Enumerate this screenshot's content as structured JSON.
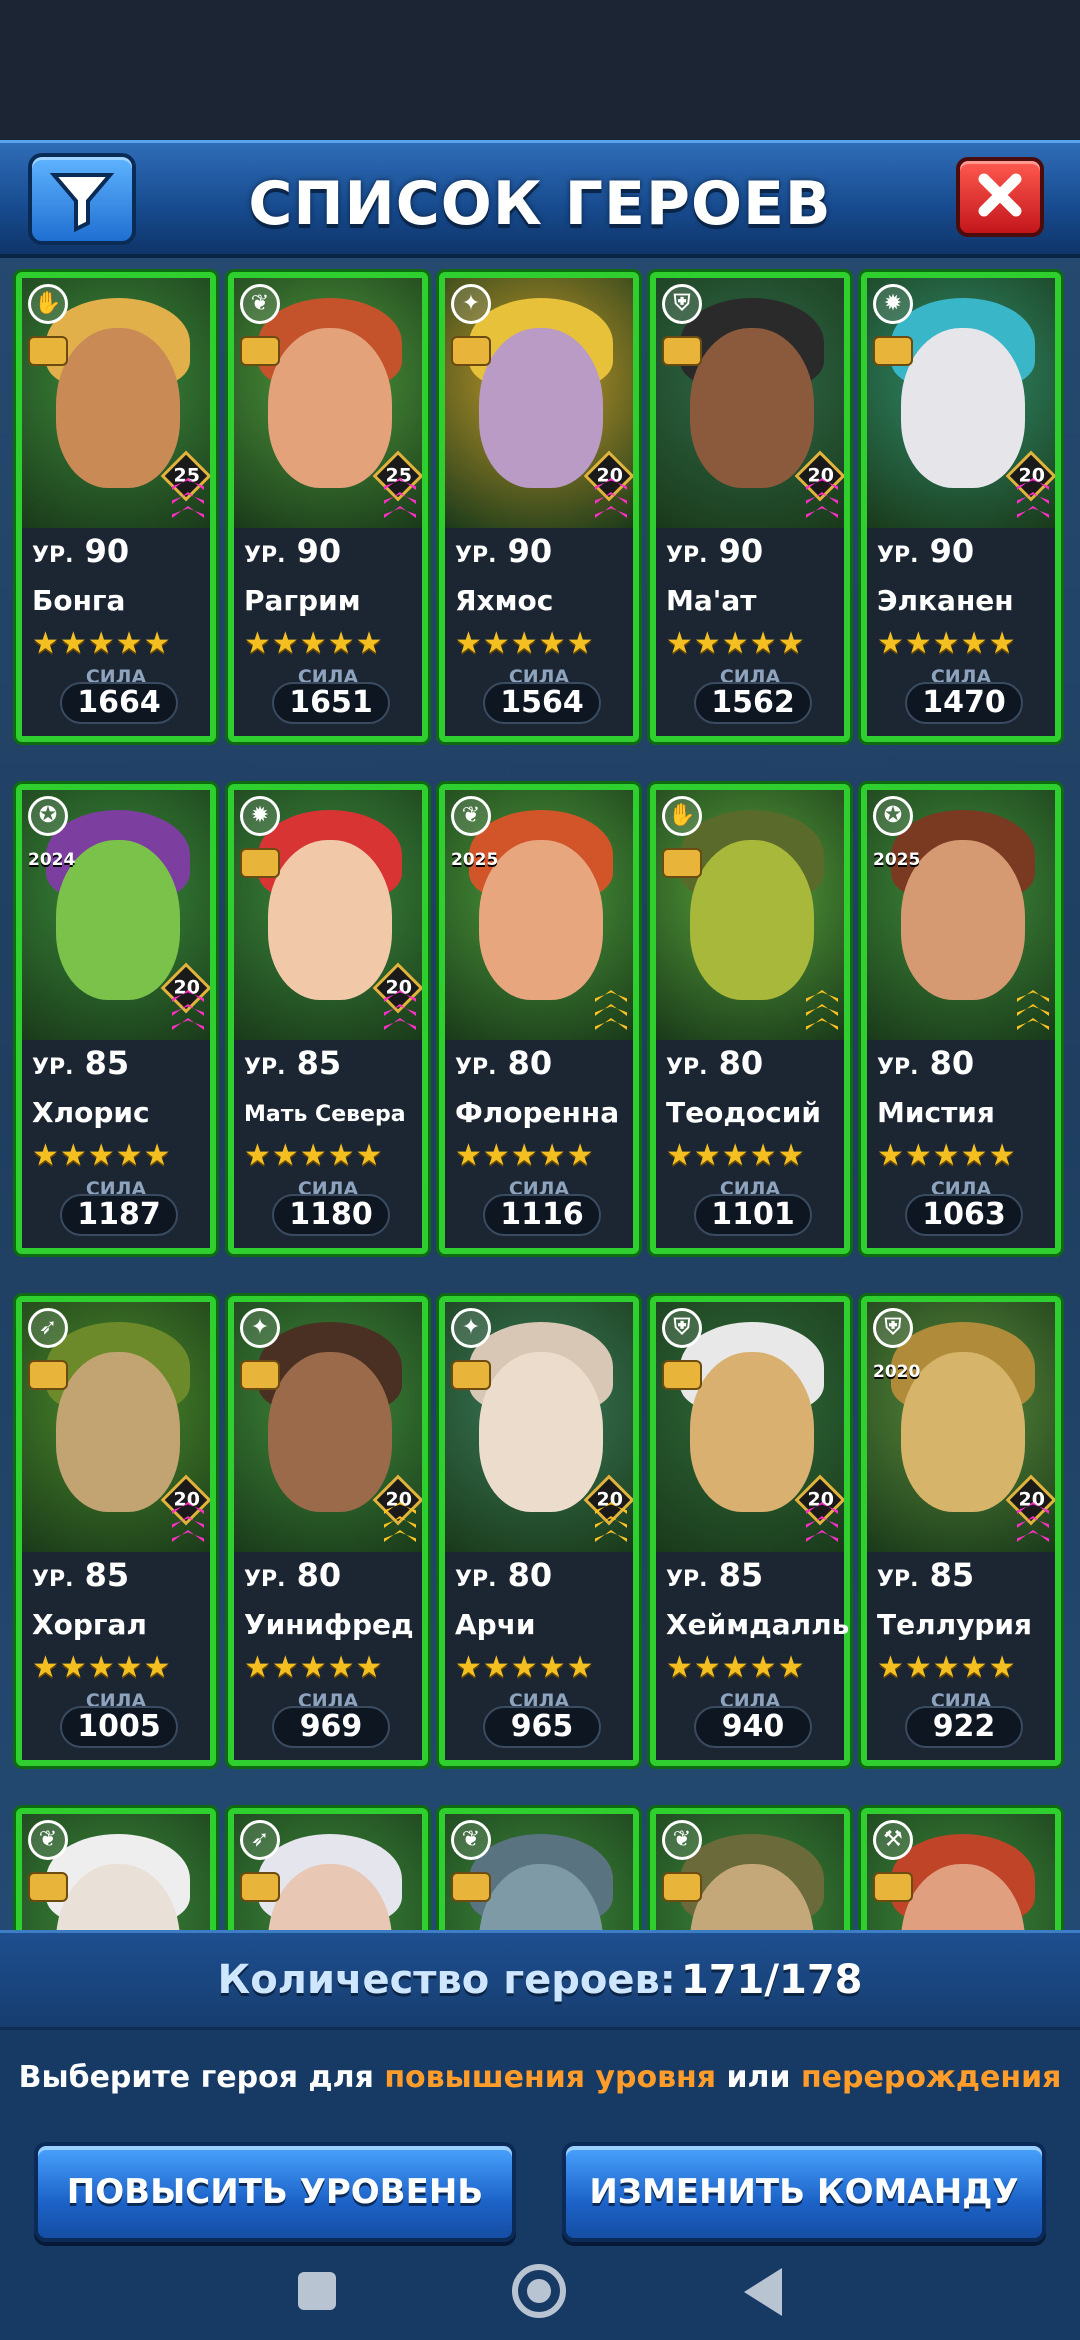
{
  "header": {
    "title": "СПИСОК ГЕРОЕВ"
  },
  "level_prefix": "УР.",
  "power_label": "СИЛА",
  "heroes": [
    {
      "name": "Бонга",
      "level": "90",
      "stars": "★★★★★",
      "power": "1664",
      "lvl_badge": "25",
      "class": "✋",
      "bg": "#3d8a3a",
      "skin": "#c98a55",
      "hair": "#e2b04a",
      "chev": "#ff2fc8"
    },
    {
      "name": "Рагрим",
      "level": "90",
      "stars": "★★★★★",
      "power": "1651",
      "lvl_badge": "25",
      "class": "❦",
      "bg": "#4f9a3c",
      "skin": "#e3a27a",
      "hair": "#c4532c",
      "chev": "#ff2fc8"
    },
    {
      "name": "Яхмос",
      "level": "90",
      "stars": "★★★★★",
      "power": "1564",
      "lvl_badge": "20",
      "class": "✦",
      "bg": "#c89b2a",
      "skin": "#b99bc5",
      "hair": "#e7c13a",
      "chev": "#ff2fc8"
    },
    {
      "name": "Ма'ат",
      "level": "90",
      "stars": "★★★★★",
      "power": "1562",
      "lvl_badge": "20",
      "class": "⛨",
      "bg": "#2f6a4a",
      "skin": "#8b5a3c",
      "hair": "#2a2a2a",
      "chev": "#ff2fc8"
    },
    {
      "name": "Элканен",
      "level": "90",
      "stars": "★★★★★",
      "power": "1470",
      "lvl_badge": "20",
      "class": "✹",
      "bg": "#2f8c6c",
      "skin": "#e6e6ea",
      "hair": "#3ab6c9",
      "chev": "#ff2fc8"
    },
    {
      "name": "Хлорис",
      "level": "85",
      "stars": "★★★★★",
      "power": "1187",
      "lvl_badge": "20",
      "class": "✪",
      "bg": "#3a8a3a",
      "skin": "#7bc24a",
      "hair": "#7c3fa0",
      "chev": "#ff2fc8",
      "year": "2024"
    },
    {
      "name": "Мать Севера",
      "level": "85",
      "stars": "★★★★★",
      "power": "1180",
      "lvl_badge": "20",
      "class": "✹",
      "bg": "#3c8a3c",
      "skin": "#f1c9a8",
      "hair": "#d83434",
      "chev": "#ff2fc8",
      "small": true
    },
    {
      "name": "Флоренна",
      "level": "80",
      "stars": "★★★★★",
      "power": "1116",
      "lvl_badge": "",
      "class": "❦",
      "bg": "#4c9a3a",
      "skin": "#e8a67e",
      "hair": "#d2552a",
      "chev": "#ffc21f",
      "year": "2025"
    },
    {
      "name": "Теодосий",
      "level": "80",
      "stars": "★★★★★",
      "power": "1101",
      "lvl_badge": "",
      "class": "✋",
      "bg": "#56a03a",
      "skin": "#a8b83a",
      "hair": "#5a6a2a",
      "chev": "#ffc21f"
    },
    {
      "name": "Мистия",
      "level": "80",
      "stars": "★★★★★",
      "power": "1063",
      "lvl_badge": "",
      "class": "✪",
      "bg": "#3f8c3a",
      "skin": "#d69a72",
      "hair": "#7a3a22",
      "chev": "#ffc21f",
      "year": "2025"
    },
    {
      "name": "Хоргал",
      "level": "85",
      "stars": "★★★★★",
      "power": "1005",
      "lvl_badge": "20",
      "class": "➶",
      "bg": "#4c8a2a",
      "skin": "#c2a472",
      "hair": "#6c8a2a",
      "chev": "#ff2fc8"
    },
    {
      "name": "Уинифред",
      "level": "80",
      "stars": "★★★★★",
      "power": "969",
      "lvl_badge": "20",
      "class": "✦",
      "bg": "#3f8a3a",
      "skin": "#9a6a4a",
      "hair": "#4a3022",
      "chev": "#ffc21f"
    },
    {
      "name": "Арчи",
      "level": "80",
      "stars": "★★★★★",
      "power": "965",
      "lvl_badge": "20",
      "class": "✦",
      "bg": "#3a7a5a",
      "skin": "#ecdccc",
      "hair": "#d8c7b4",
      "chev": "#ffc21f"
    },
    {
      "name": "Хеймдалль",
      "level": "85",
      "stars": "★★★★★",
      "power": "940",
      "lvl_badge": "20",
      "class": "⛨",
      "bg": "#2f6a3a",
      "skin": "#d9b070",
      "hair": "#e8e8e8",
      "chev": "#ff2fc8"
    },
    {
      "name": "Теллурия",
      "level": "85",
      "stars": "★★★★★",
      "power": "922",
      "lvl_badge": "20",
      "class": "⛨",
      "bg": "#5a8a3a",
      "skin": "#d6b46a",
      "hair": "#b08c3a",
      "chev": "#ff2fc8",
      "year": "2020"
    }
  ],
  "partial_heroes": [
    {
      "class": "❦",
      "skin": "#e9e1d8",
      "hair": "#eeeeee"
    },
    {
      "class": "➶",
      "skin": "#e8c8b4",
      "hair": "#e5e5ee"
    },
    {
      "class": "❦",
      "skin": "#7d9aa6",
      "hair": "#5a7380"
    },
    {
      "class": "❦",
      "skin": "#c4a87a",
      "hair": "#6b6a3a"
    },
    {
      "class": "⚒",
      "skin": "#e0a080",
      "hair": "#c04428"
    }
  ],
  "footer": {
    "count_label": "Количество героев:",
    "count_value": "171/178",
    "hint_pre": "Выберите героя для ",
    "hint_hl1": "повышения уровня",
    "hint_mid": " или ",
    "hint_hl2": "перерождения",
    "level_up_button": "ПОВЫСИТЬ УРОВЕНЬ",
    "change_team_button": "ИЗМЕНИТЬ КОМАНДУ"
  },
  "icons": {
    "filter": "filter-icon",
    "close": "close-icon"
  }
}
